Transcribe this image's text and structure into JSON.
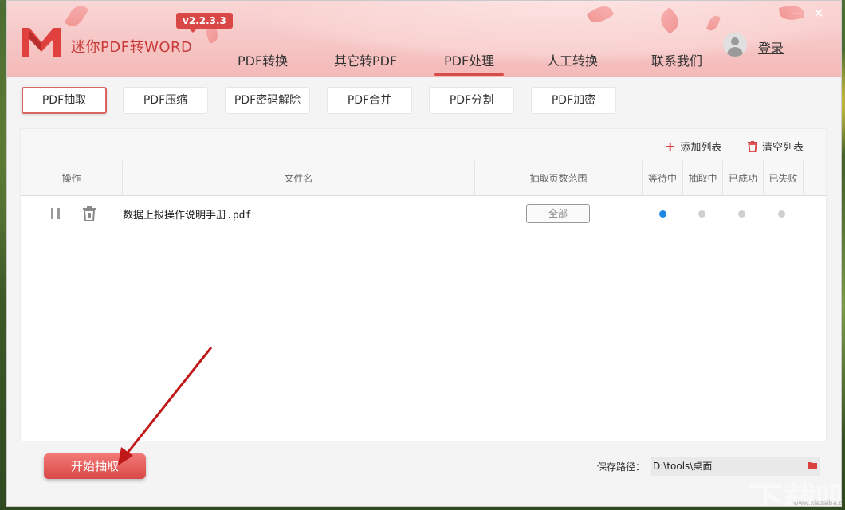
{
  "app": {
    "title": "迷你PDF转WORD",
    "version": "v2.2.3.3"
  },
  "nav": {
    "items": [
      {
        "label": "PDF转换"
      },
      {
        "label": "其它转PDF"
      },
      {
        "label": "PDF处理"
      },
      {
        "label": "人工转换"
      },
      {
        "label": "联系我们"
      }
    ],
    "active_index": 2
  },
  "user": {
    "login_label": "登录"
  },
  "window_controls": {
    "minimize": "—",
    "close": "✕"
  },
  "subtabs": {
    "items": [
      {
        "label": "PDF抽取"
      },
      {
        "label": "PDF压缩"
      },
      {
        "label": "PDF密码解除"
      },
      {
        "label": "PDF合并"
      },
      {
        "label": "PDF分割"
      },
      {
        "label": "PDF加密"
      }
    ],
    "active_index": 0
  },
  "toolbar": {
    "add_list": "添加列表",
    "clear_list": "清空列表"
  },
  "table": {
    "columns": [
      "操作",
      "文件名",
      "抽取页数范围",
      "等待中",
      "抽取中",
      "已成功",
      "已失败"
    ],
    "rows": [
      {
        "filename": "数据上报操作说明手册.pdf",
        "range": "全部",
        "status": "waiting"
      }
    ]
  },
  "footer": {
    "start_button": "开始抽取",
    "save_label": "保存路径：",
    "save_path": "D:\\tools\\桌面"
  },
  "watermark": {
    "text": "下载吧",
    "url": "www.xiazaiba.com"
  },
  "colors": {
    "accent": "#d94846",
    "status_active": "#1e88e5",
    "status_inactive": "#cfcfcf"
  },
  "icons": {
    "add": "plus-icon",
    "clear": "trash-icon",
    "pause": "pause-icon",
    "delete": "trash-icon",
    "folder": "folder-icon",
    "user": "user-avatar-icon"
  }
}
